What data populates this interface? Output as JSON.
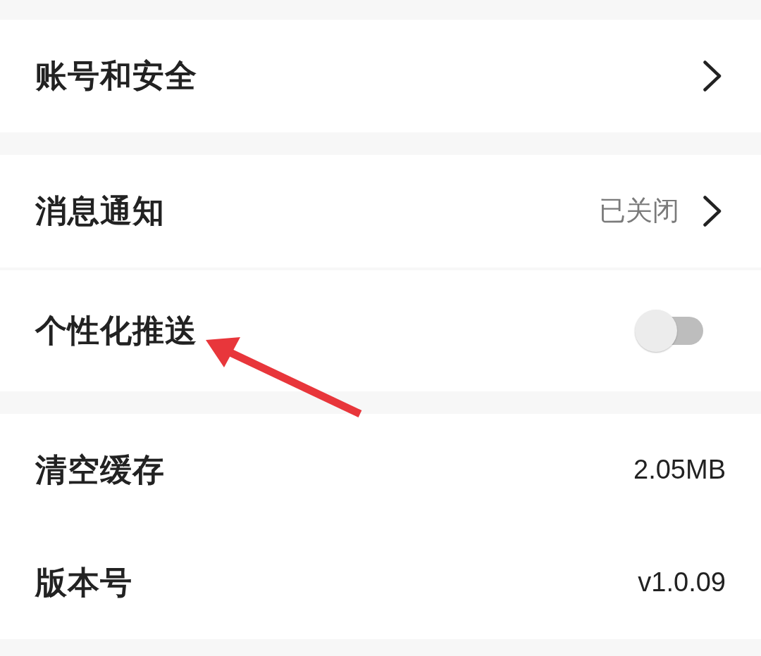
{
  "sections": [
    {
      "rows": [
        {
          "kind": "link",
          "label": "账号和安全"
        }
      ]
    },
    {
      "dividers": true,
      "rows": [
        {
          "kind": "link",
          "label": "消息通知",
          "value": "已关闭"
        },
        {
          "kind": "toggle",
          "label": "个性化推送",
          "on": false
        }
      ]
    },
    {
      "dividers": false,
      "rows": [
        {
          "kind": "value",
          "label": "清空缓存",
          "value": "2.05MB"
        },
        {
          "kind": "value",
          "label": "版本号",
          "value": "v1.0.09"
        }
      ]
    }
  ]
}
